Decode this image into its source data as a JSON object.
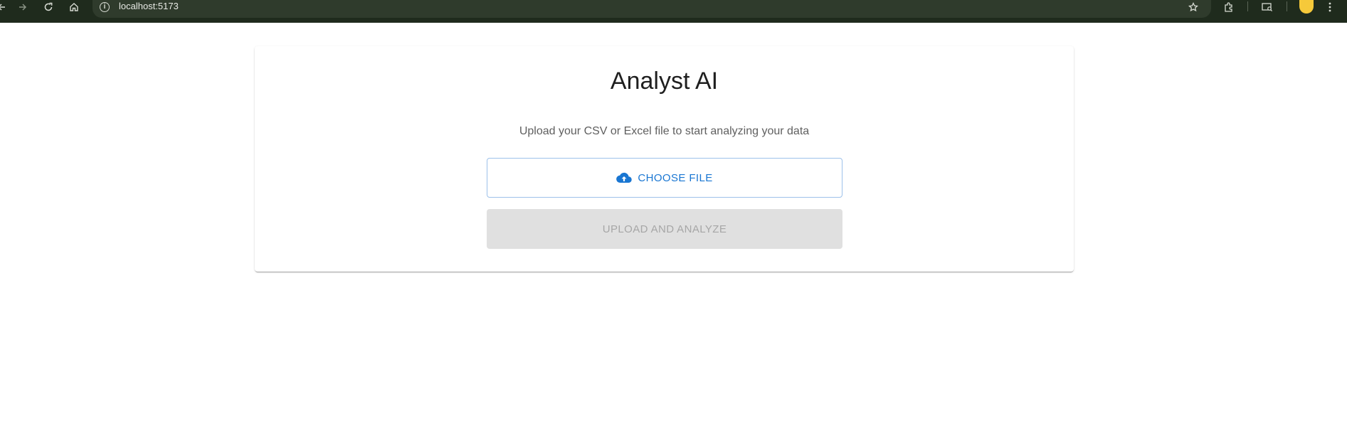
{
  "browser": {
    "url": "localhost:5173",
    "icons": [
      "back-icon",
      "forward-icon",
      "reload-icon",
      "home-icon",
      "site-info-icon",
      "star-icon",
      "extensions-icon",
      "tab-search-icon",
      "profile-avatar",
      "menu-icon"
    ],
    "avatar_color": "#f6c93a"
  },
  "app": {
    "title": "Analyst AI",
    "subtitle": "Upload your CSV or Excel file to start analyzing your data",
    "choose_file_label": "CHOOSE FILE",
    "upload_label": "UPLOAD AND ANALYZE",
    "accent_color": "#1976d2"
  }
}
